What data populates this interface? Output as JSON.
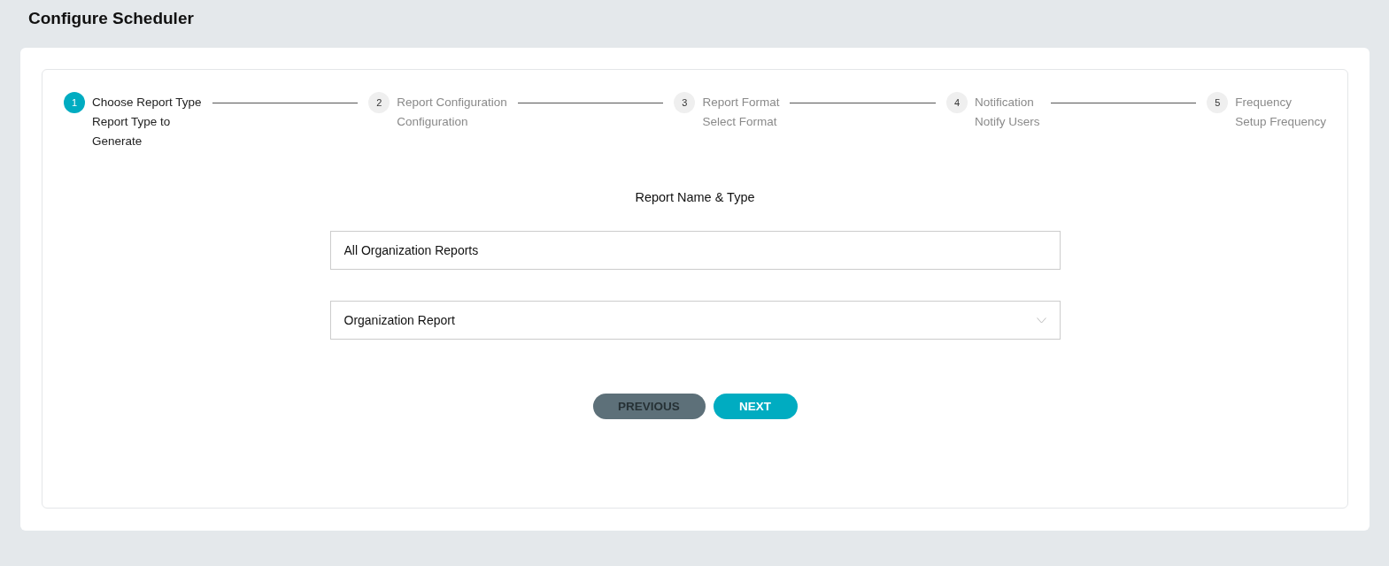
{
  "page": {
    "title": "Configure Scheduler"
  },
  "steps": [
    {
      "number": "1",
      "title": "Choose Report Type",
      "subtitle": "Report Type to Generate",
      "selected": true
    },
    {
      "number": "2",
      "title": "Report Configuration",
      "subtitle": "Configuration",
      "selected": false
    },
    {
      "number": "3",
      "title": "Report Format",
      "subtitle": "Select Format",
      "selected": false
    },
    {
      "number": "4",
      "title": "Notification",
      "subtitle": "Notify Users",
      "selected": false
    },
    {
      "number": "5",
      "title": "Frequency",
      "subtitle": "Setup Frequency",
      "selected": false
    }
  ],
  "form": {
    "heading": "Report Name & Type",
    "name_field": {
      "value": "All Organization Reports"
    },
    "type_select": {
      "value": "Organization Report"
    }
  },
  "buttons": [
    {
      "label": "PREVIOUS",
      "kind": "previous",
      "disabled": true
    },
    {
      "label": "NEXT",
      "kind": "next",
      "disabled": false
    }
  ]
}
